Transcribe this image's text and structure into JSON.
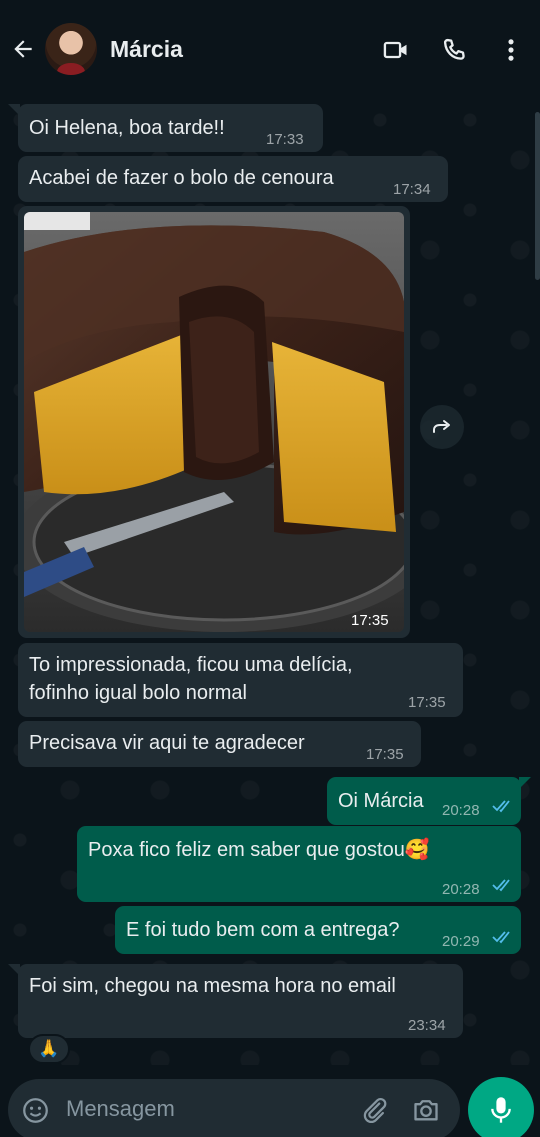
{
  "header": {
    "contact_name": "Márcia"
  },
  "messages": [
    {
      "direction": "in",
      "text": "Oi Helena, boa tarde!!",
      "time": "17:33"
    },
    {
      "direction": "in",
      "text": "Acabei de fazer o bolo de cenoura",
      "time": "17:34"
    },
    {
      "direction": "in",
      "type": "image",
      "time": "17:35"
    },
    {
      "direction": "in",
      "line1": "To impressionada, ficou uma delícia,",
      "line2": "fofinho igual bolo normal",
      "time": "17:35"
    },
    {
      "direction": "in",
      "text": "Precisava vir aqui te agradecer",
      "time": "17:35"
    },
    {
      "direction": "out",
      "text": "Oi Márcia",
      "time": "20:28",
      "status": "read"
    },
    {
      "direction": "out",
      "text": "Poxa fico feliz em saber que gostou",
      "emoji": "🥰",
      "time": "20:28",
      "status": "read"
    },
    {
      "direction": "out",
      "text": "E foi tudo bem com a entrega?",
      "time": "20:29",
      "status": "read"
    },
    {
      "direction": "in",
      "text": "Foi sim, chegou na mesma hora no email",
      "time": "23:34",
      "reaction": "🙏"
    }
  ],
  "composer": {
    "placeholder": "Mensagem"
  },
  "icons": {
    "back": "arrow-left-icon",
    "video": "video-camera-icon",
    "call": "phone-icon",
    "menu": "more-vert-icon",
    "forward": "forward-icon",
    "emoji": "emoji-icon",
    "attach": "paperclip-icon",
    "camera": "camera-icon",
    "mic": "microphone-icon"
  },
  "colors": {
    "background": "#0b141a",
    "incoming_bubble": "#202c33",
    "outgoing_bubble": "#005c4b",
    "read_ticks": "#53bdeb",
    "accent": "#00a884"
  }
}
